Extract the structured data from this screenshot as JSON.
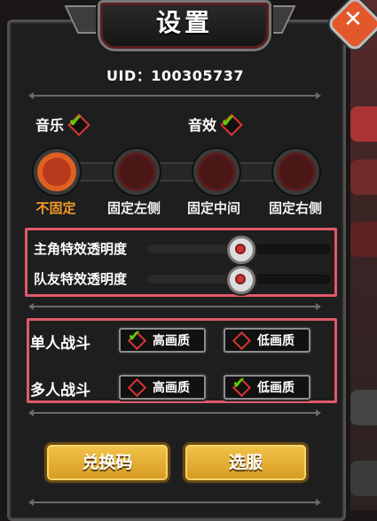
{
  "title": "设置",
  "close_icon": "close-icon",
  "uid_text": "UID：100305737",
  "toggles": {
    "music_label": "音乐",
    "sound_label": "音效",
    "music_on": true,
    "sound_on": true
  },
  "position": {
    "options": [
      "不固定",
      "固定左侧",
      "固定中间",
      "固定右侧"
    ],
    "selected_index": 0
  },
  "sliders": [
    {
      "label": "主角特效透明度",
      "value_percent": 50
    },
    {
      "label": "队友特效透明度",
      "value_percent": 50
    }
  ],
  "battle": {
    "single_label": "单人战斗",
    "multi_label": "多人战斗",
    "high_label": "高画质",
    "low_label": "低画质",
    "single_selected": "high",
    "multi_selected": "low"
  },
  "buttons": {
    "redeem_label": "兑换码",
    "server_label": "选服"
  },
  "colors": {
    "accent_orange": "#f39a2a",
    "check_green": "#5fd000",
    "highlight_box": "#e0596a",
    "button_gold": "#f3c44a"
  }
}
